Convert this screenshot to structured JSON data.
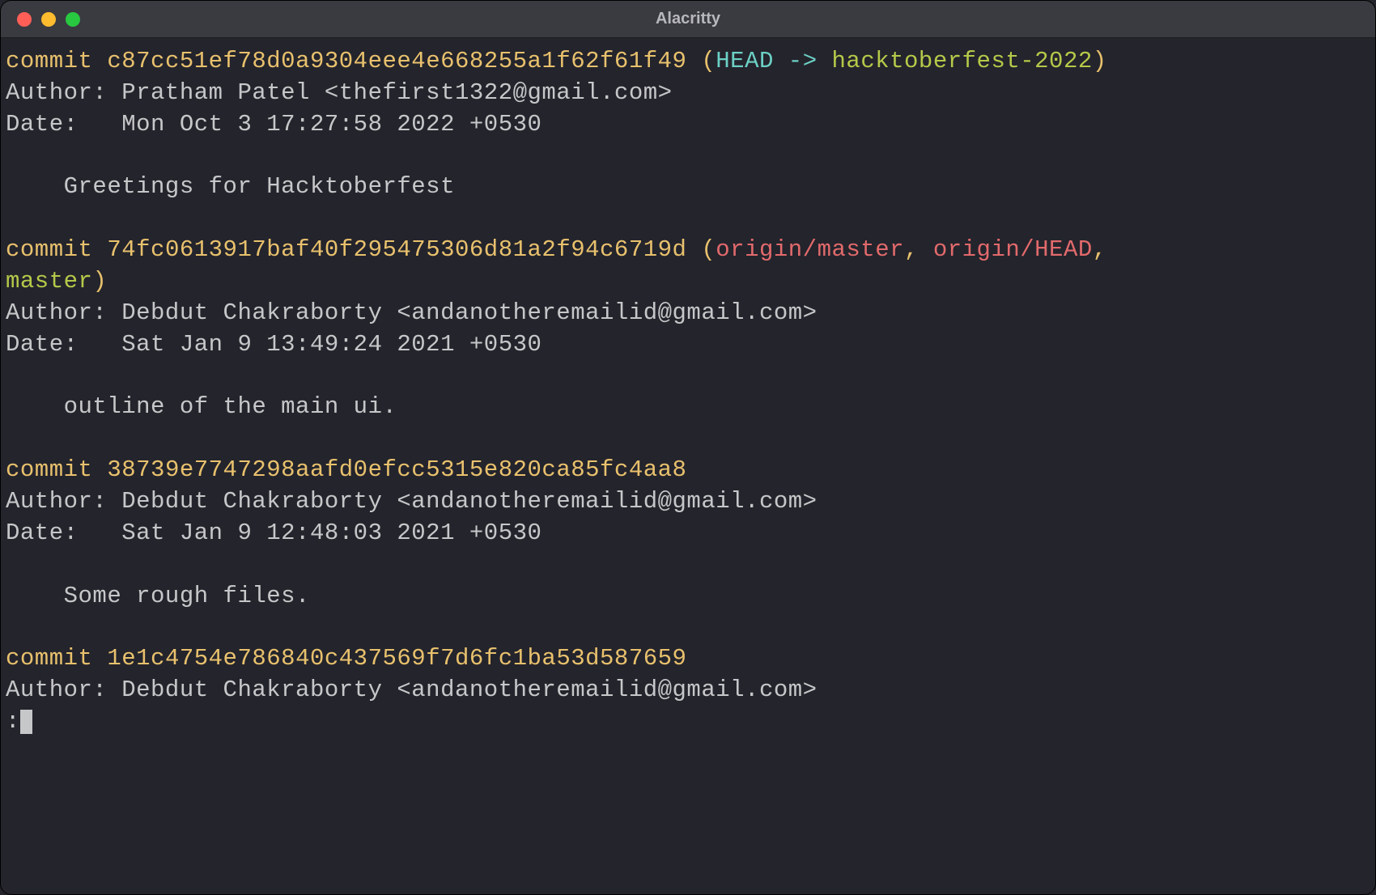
{
  "window": {
    "title": "Alacritty"
  },
  "colors": {
    "yellow": "#e8c16d",
    "cyan": "#6cd0c5",
    "green": "#b5c949",
    "red": "#e26a6c",
    "text": "#c6c7c9",
    "bg": "#24242c"
  },
  "commits": [
    {
      "hash": "c87cc51ef78d0a9304eee4e668255a1f62f61f49",
      "refs": {
        "head": "HEAD",
        "arrow": " -> ",
        "branch": "hacktoberfest-2022"
      },
      "author_line": "Author: Pratham Patel <thefirst1322@gmail.com>",
      "date_line": "Date:   Mon Oct 3 17:27:58 2022 +0530",
      "message": "    Greetings for Hacktoberfest"
    },
    {
      "hash": "74fc0613917baf40f295475306d81a2f94c6719d",
      "refs_remote": [
        "origin/master",
        "origin/HEAD"
      ],
      "refs_local_branch": "master",
      "author_line": "Author: Debdut Chakraborty <andanotheremailid@gmail.com>",
      "date_line": "Date:   Sat Jan 9 13:49:24 2021 +0530",
      "message": "    outline of the main ui."
    },
    {
      "hash": "38739e7747298aafd0efcc5315e820ca85fc4aa8",
      "author_line": "Author: Debdut Chakraborty <andanotheremailid@gmail.com>",
      "date_line": "Date:   Sat Jan 9 12:48:03 2021 +0530",
      "message": "    Some rough files."
    },
    {
      "hash": "1e1c4754e786840c437569f7d6fc1ba53d587659",
      "author_line": "Author: Debdut Chakraborty <andanotheremailid@gmail.com>"
    }
  ],
  "labels": {
    "commit_word": "commit ",
    "paren_open": " (",
    "paren_close": ")",
    "comma_sep": ", ",
    "prompt": ":"
  }
}
